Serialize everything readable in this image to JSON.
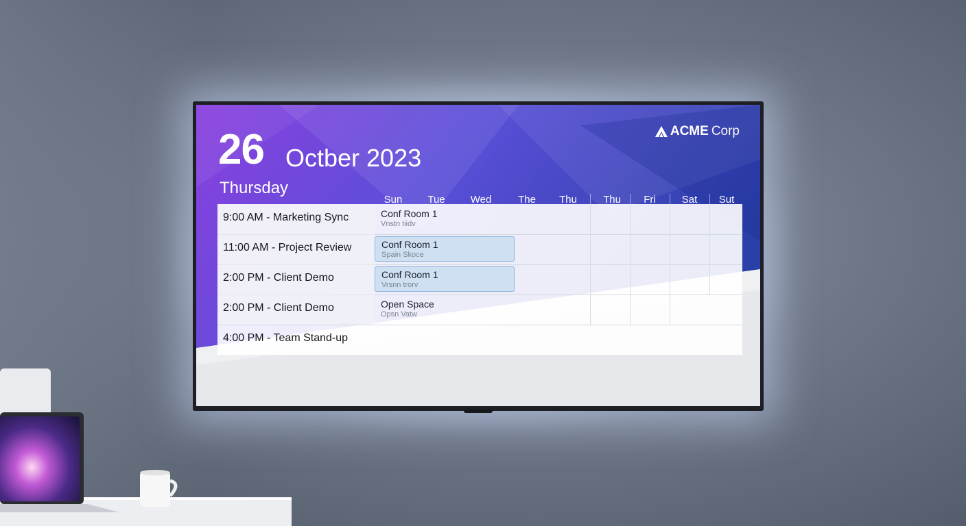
{
  "display": {
    "date_day": "26",
    "date_month_year": "Octber 2023",
    "weekday": "Thursday",
    "brand": {
      "name_strong": "ACME",
      "name_light": "Corp",
      "icon": "acme-logo-icon"
    },
    "day_headers": [
      "Sun",
      "Tue",
      "Wed",
      "The",
      "Thu",
      "Thu",
      "Fri",
      "Sat",
      "Sut"
    ],
    "events": [
      {
        "title": "9:00 AM - Marketing Sync",
        "room": "Conf Room 1",
        "room_sub": "Vnstn tiidv",
        "highlighted": false
      },
      {
        "title": "11:00 AM - Project Review",
        "room": "Conf Room 1",
        "room_sub": "Spain Skoce",
        "highlighted": true
      },
      {
        "title": "2:00 PM - Client Demo",
        "room": "Conf Room 1",
        "room_sub": "Vrsnn trorv",
        "highlighted": true
      },
      {
        "title": "2:00 PM - Client Demo",
        "room": "Open Space",
        "room_sub": "Opsn Vatw",
        "highlighted": false
      },
      {
        "title": "4:00 PM - Team Stand-up",
        "room": "",
        "room_sub": "",
        "highlighted": false
      }
    ]
  },
  "colors": {
    "gradient_top_left": "#8b3fe0",
    "gradient_top_right": "#2b3fa8",
    "panel_bottom": "#e6e8ec",
    "highlight_fill": "#cfe0f3",
    "highlight_border": "#8fb2d9"
  }
}
